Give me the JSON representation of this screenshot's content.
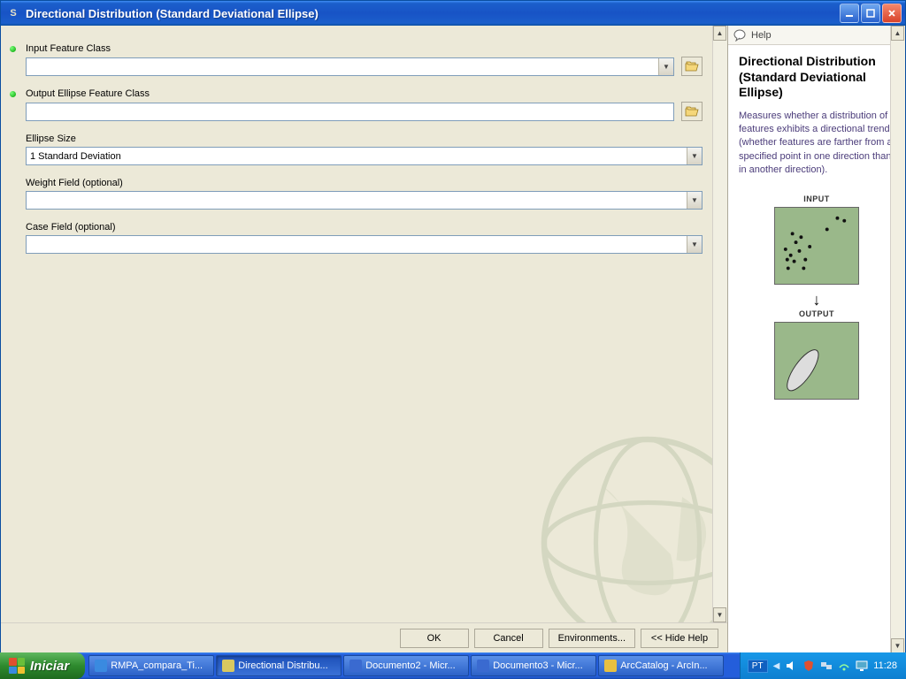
{
  "titlebar": {
    "app_icon": "S",
    "title": "Directional Distribution (Standard Deviational Ellipse)"
  },
  "fields": {
    "input_feature_class": {
      "label": "Input Feature Class",
      "value": "",
      "required": true
    },
    "output_ellipse_feature_class": {
      "label": "Output Ellipse Feature Class",
      "value": "",
      "required": true
    },
    "ellipse_size": {
      "label": "Ellipse Size",
      "value": "1 Standard Deviation"
    },
    "weight_field": {
      "label": "Weight Field (optional)",
      "value": ""
    },
    "case_field": {
      "label": "Case Field (optional)",
      "value": ""
    }
  },
  "buttons": {
    "ok": "OK",
    "cancel": "Cancel",
    "environments": "Environments...",
    "hide_help": "<< Hide Help"
  },
  "help": {
    "header": "Help",
    "title": "Directional Distribution (Standard Deviational Ellipse)",
    "description": "Measures whether a distribution of features exhibits a directional trend (whether features are farther from a specified point in one direction than in another direction).",
    "input_label": "INPUT",
    "output_label": "OUTPUT"
  },
  "taskbar": {
    "start": "Iniciar",
    "tasks": [
      {
        "label": "RMPA_compara_Ti...",
        "active": false
      },
      {
        "label": "Directional Distribu...",
        "active": true
      },
      {
        "label": "Documento2 - Micr...",
        "active": false
      },
      {
        "label": "Documento3 - Micr...",
        "active": false
      },
      {
        "label": "ArcCatalog - ArcIn...",
        "active": false
      }
    ],
    "language": "PT",
    "clock": "11:28"
  }
}
